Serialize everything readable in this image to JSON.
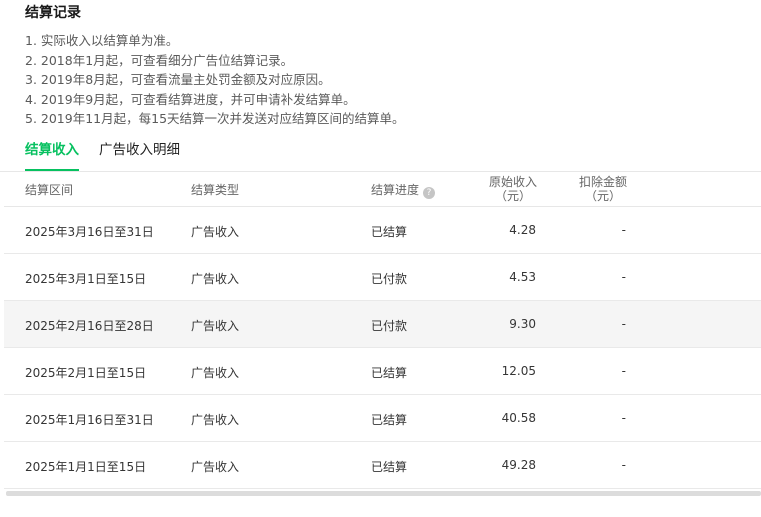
{
  "title": "结算记录",
  "notes": [
    "1. 实际收入以结算单为准。",
    "2. 2018年1月起，可查看细分广告位结算记录。",
    "3. 2019年8月起，可查看流量主处罚金额及对应原因。",
    "4. 2019年9月起，可查看结算进度，并可申请补发结算单。",
    "5. 2019年11月起，每15天结算一次并发送对应结算区间的结算单。"
  ],
  "tabs": [
    {
      "label": "结算收入",
      "active": true
    },
    {
      "label": "广告收入明细",
      "active": false
    }
  ],
  "table": {
    "headers": {
      "period": "结算区间",
      "type": "结算类型",
      "progress": "结算进度",
      "help_icon": "?",
      "income_line1": "原始收入",
      "income_line2": "（元）",
      "deduction_line1": "扣除金额",
      "deduction_line2": "（元）"
    },
    "rows": [
      {
        "period": "2025年3月16日至31日",
        "type": "广告收入",
        "status": "已结算",
        "income": "4.28",
        "deduction": "-"
      },
      {
        "period": "2025年3月1日至15日",
        "type": "广告收入",
        "status": "已付款",
        "income": "4.53",
        "deduction": "-"
      },
      {
        "period": "2025年2月16日至28日",
        "type": "广告收入",
        "status": "已付款",
        "income": "9.30",
        "deduction": "-"
      },
      {
        "period": "2025年2月1日至15日",
        "type": "广告收入",
        "status": "已结算",
        "income": "12.05",
        "deduction": "-"
      },
      {
        "period": "2025年1月16日至31日",
        "type": "广告收入",
        "status": "已结算",
        "income": "40.58",
        "deduction": "-"
      },
      {
        "period": "2025年1月1日至15日",
        "type": "广告收入",
        "status": "已结算",
        "income": "49.28",
        "deduction": "-"
      }
    ]
  },
  "colors": {
    "accent": "#07c160",
    "row_highlight": "#f5f5f5"
  }
}
